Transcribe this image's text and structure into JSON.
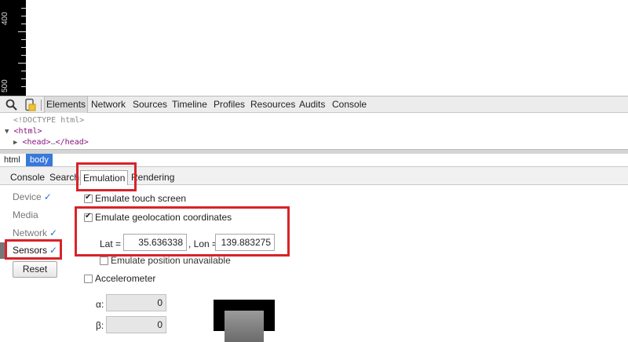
{
  "ruler": {
    "labels": [
      "400",
      "500"
    ]
  },
  "toolbar": {
    "tabs": [
      "Elements",
      "Network",
      "Sources",
      "Timeline",
      "Profiles",
      "Resources",
      "Audits",
      "Console"
    ],
    "active": "Elements"
  },
  "dom": {
    "doctype": "<!DOCTYPE html>",
    "html_tag": "<html>",
    "head_tag": "<head>",
    "head_ellipsis": "…",
    "head_close": "</head>"
  },
  "breadcrumbs": [
    "html",
    "body"
  ],
  "drawer": {
    "tabs": [
      "Console",
      "Search",
      "Emulation",
      "Rendering"
    ],
    "active": "Emulation"
  },
  "sidebar": {
    "items": [
      {
        "label": "Device",
        "checked": true
      },
      {
        "label": "Media",
        "checked": false
      },
      {
        "label": "Network",
        "checked": true
      },
      {
        "label": "Sensors",
        "checked": true
      }
    ],
    "check_glyph": "✓",
    "reset_label": "Reset"
  },
  "sensors": {
    "touch": {
      "label": "Emulate touch screen",
      "checked": true
    },
    "geo": {
      "label": "Emulate geolocation coordinates",
      "checked": true,
      "lat_label": "Lat =",
      "lat_value": "35.636338",
      "lon_label": ", Lon =",
      "lon_value": "139.883275",
      "unavailable_label": "Emulate position unavailable",
      "unavailable_checked": false
    },
    "accelerometer": {
      "label": "Accelerometer",
      "checked": false,
      "alpha_label": "α:",
      "alpha_value": "0",
      "beta_label": "β:",
      "beta_value": "0"
    }
  },
  "colors": {
    "highlight": "#d8232a",
    "selected_crumb": "#3879d9",
    "check": "#2a6ed1"
  }
}
